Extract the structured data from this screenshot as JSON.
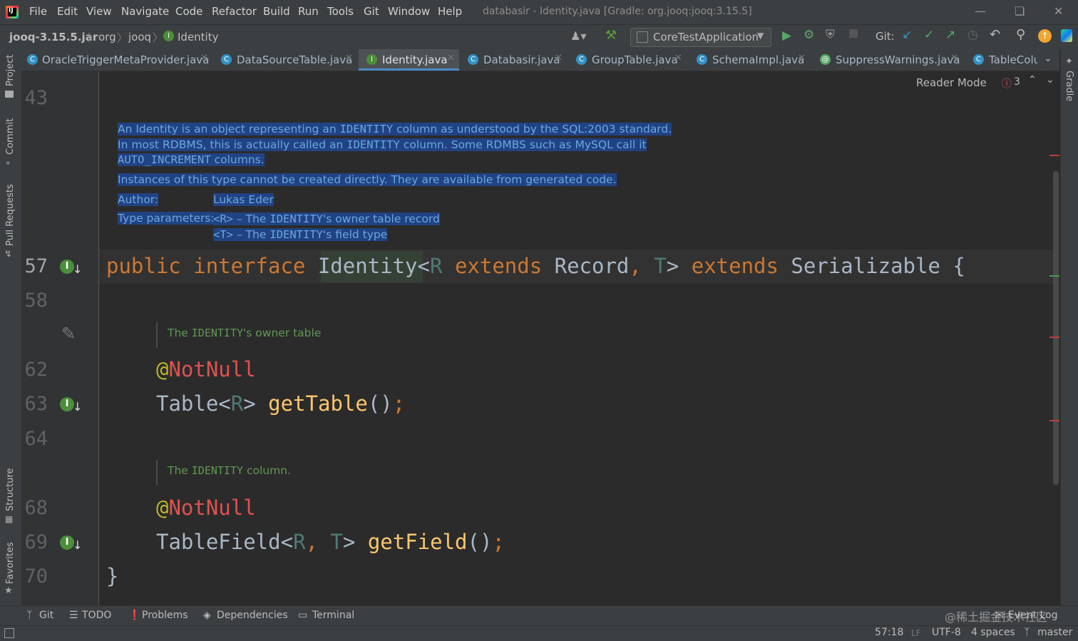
{
  "menu": {
    "items": [
      "File",
      "Edit",
      "View",
      "Navigate",
      "Code",
      "Refactor",
      "Build",
      "Run",
      "Tools",
      "Git",
      "Window",
      "Help"
    ],
    "window_title": "databasir - Identity.java [Gradle: org.jooq:jooq:3.15.5]"
  },
  "breadcrumb": [
    "jooq-3.15.5.jar",
    "org",
    "jooq",
    "Identity"
  ],
  "toolbar": {
    "run_config": "CoreTestApplication",
    "git_label": "Git:"
  },
  "tabs": [
    {
      "label": "OracleTriggerMetaProvider.java",
      "icon": "C"
    },
    {
      "label": "DataSourceTable.java",
      "icon": "C"
    },
    {
      "label": "Identity.java",
      "icon": "I",
      "active": true
    },
    {
      "label": "Databasir.java",
      "icon": "C"
    },
    {
      "label": "GroupTable.java",
      "icon": "C"
    },
    {
      "label": "SchemaImpl.java",
      "icon": "C"
    },
    {
      "label": "SuppressWarnings.java",
      "icon": "@"
    },
    {
      "label": "TableColu",
      "icon": "C"
    }
  ],
  "left_tools": [
    "Project",
    "Commit",
    "Pull Requests",
    "Structure",
    "Favorites"
  ],
  "right_tools": [
    "Gradle"
  ],
  "reader": {
    "mode_label": "Reader Mode",
    "error_count": "3"
  },
  "gutter": {
    "lines": [
      "43",
      "57",
      "58",
      "62",
      "63",
      "64",
      "68",
      "69",
      "70"
    ]
  },
  "javadoc": {
    "p1_a": "An Identity is an object representing an ",
    "p1_b": "IDENTITY",
    "p1_c": " column as understood by the SQL:2003 standard.",
    "p2_a": "In most RDBMS, this is actually called an ",
    "p2_b": "IDENTITY",
    "p2_c": " column. Some RDMBS such as MySQL call it",
    "p3_a": "AUTO_INCREMENT",
    "p3_b": " columns.",
    "p4": "Instances of this type cannot be created directly. They are available from generated code.",
    "author_label": "Author:",
    "author_value": "Lukas Eder",
    "type_params_label": "Type parameters:",
    "tp1_a": "<R>",
    "tp1_b": " – The ",
    "tp1_c": "IDENTITY",
    "tp1_d": "'s owner table record",
    "tp2_a": "<T>",
    "tp2_b": " – The ",
    "tp2_c": "IDENTITY",
    "tp2_d": "'s field type"
  },
  "code": {
    "l57_public": "public",
    "l57_interface": "interface",
    "l57_name": "Identity",
    "l57_lt": "<",
    "l57_R": "R",
    "l57_extends1": "extends",
    "l57_record": "Record",
    "l57_comma": ",",
    "l57_T": "T",
    "l57_gt": ">",
    "l57_extends2": "extends",
    "l57_serial": "Serializable",
    "l57_brace": "{",
    "doc1_a": "The ",
    "doc1_b": "IDENTITY",
    "doc1_c": "'s owner table",
    "l62_at": "@",
    "l62_ann": "NotNull",
    "l63_type": "Table<",
    "l63_R": "R",
    "l63_gt": "> ",
    "l63_meth": "getTable",
    "l63_paren": "()",
    "l63_semi": ";",
    "doc2_a": "The ",
    "doc2_b": "IDENTITY",
    "doc2_c": " column.",
    "l68_at": "@",
    "l68_ann": "NotNull",
    "l69_type": "TableField<",
    "l69_R": "R",
    "l69_comma": ", ",
    "l69_T": "T",
    "l69_gt": "> ",
    "l69_meth": "getField",
    "l69_paren": "()",
    "l69_semi": ";",
    "l70_brace": "}"
  },
  "toolwindows": [
    "Git",
    "TODO",
    "Problems",
    "Dependencies",
    "Terminal"
  ],
  "status": {
    "position": "57:18",
    "line_sep": "LF",
    "encoding": "UTF-8",
    "indent": "4 spaces",
    "branch": "master",
    "event_log": "Event Log",
    "watermark": "@稀土掘金技术社区"
  }
}
